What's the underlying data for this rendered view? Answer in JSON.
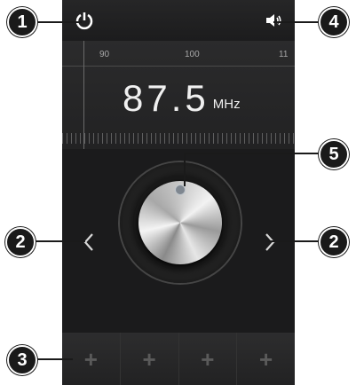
{
  "topbar": {
    "power_icon": "power-icon",
    "volume_icon": "speaker-icon"
  },
  "dial": {
    "scale_labels": [
      "90",
      "100",
      "11"
    ],
    "frequency": "87.5",
    "unit": "MHz"
  },
  "controls": {
    "prev_icon": "chevron-left-icon",
    "next_icon": "chevron-right-icon"
  },
  "favorites": [
    {
      "label": "+"
    },
    {
      "label": "+"
    },
    {
      "label": "+"
    },
    {
      "label": "+"
    }
  ],
  "callouts": [
    "1",
    "2",
    "3",
    "4",
    "5",
    "2"
  ]
}
